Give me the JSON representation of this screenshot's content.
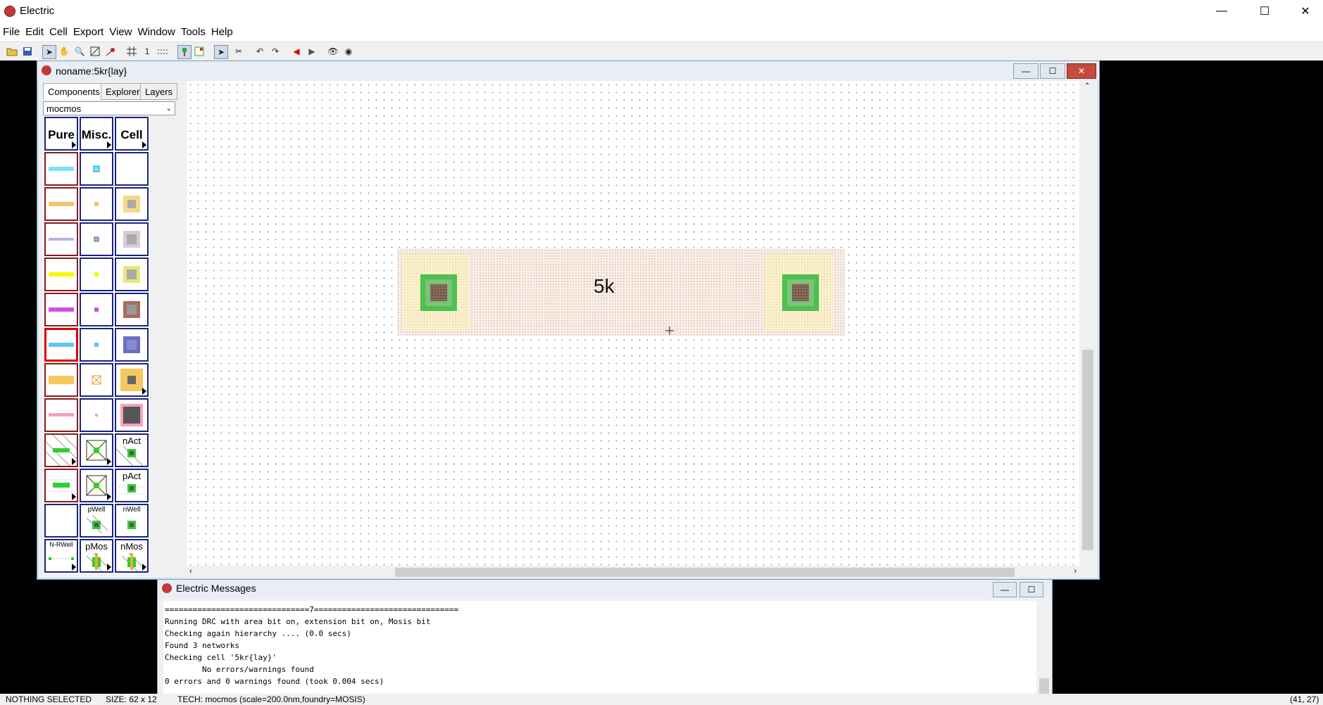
{
  "app": {
    "title": "Electric"
  },
  "menu": [
    "File",
    "Edit",
    "Cell",
    "Export",
    "View",
    "Window",
    "Tools",
    "Help"
  ],
  "toolbar": {
    "grid_number": "1"
  },
  "edit_window": {
    "title": "noname:5kr{lay}",
    "tabs": [
      "Components",
      "Explorer",
      "Layers"
    ],
    "technology": "mocmos",
    "palette_headers": [
      "Pure",
      "Misc.",
      "Cell"
    ],
    "palette_labels": {
      "nact": "nAct",
      "pact": "pAct",
      "pwell": "pWell",
      "nwell": "nWell",
      "nrwell": "N-RWell",
      "pmos": "pMos",
      "nmos": "nMos"
    },
    "resistor_label": "5k"
  },
  "messages": {
    "title": "Electric Messages",
    "lines": [
      "===============================7===============================",
      "Running DRC with area bit on, extension bit on, Mosis bit",
      "Checking again hierarchy .... (0.0 secs)",
      "Found 3 networks",
      "Checking cell '5kr{lay}'",
      "        No errors/warnings found",
      "0 errors and 0 warnings found (took 0.004 secs)"
    ]
  },
  "status": {
    "selection": "NOTHING SELECTED",
    "size": "SIZE: 62 x 12",
    "tech": "TECH: mocmos (scale=200.0nm,foundry=MOSIS)",
    "coords": "(41, 27)"
  }
}
